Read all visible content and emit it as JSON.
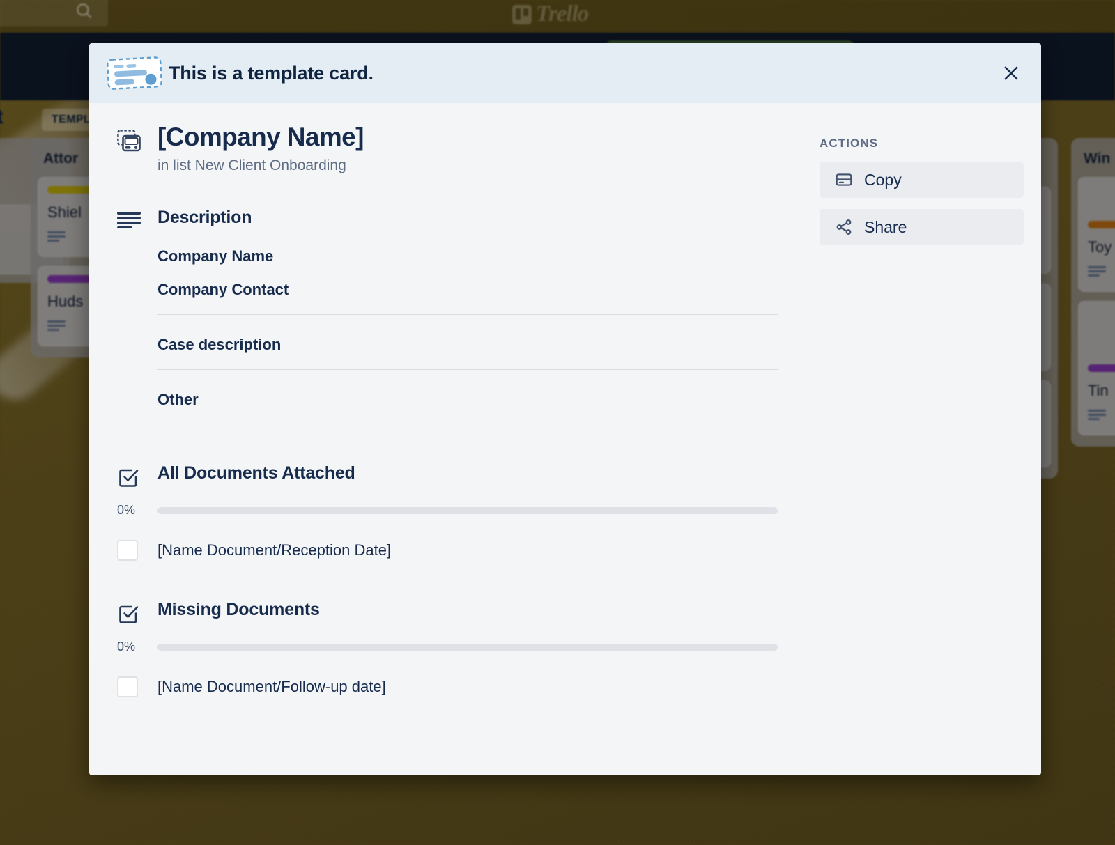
{
  "background": {
    "app_name": "Trello",
    "search_icon": "search-icon",
    "board_title_partial": "nt",
    "template_chip": "TEMPL",
    "lists": [
      {
        "title_partial": "Attor",
        "cards": [
          {
            "title_partial": "Shiel",
            "label_color": "#9a8c0c"
          },
          {
            "title_partial": "Huds",
            "label_color": "#6b2d8f"
          }
        ]
      },
      {
        "title_partial": "Win",
        "cards": [
          {
            "title_partial": "Toy",
            "label_color": "#9c5a10"
          },
          {
            "title_partial": "Tin",
            "label_color": "#6b2d8f"
          }
        ]
      }
    ]
  },
  "modal": {
    "banner": {
      "title": "This is a template card.",
      "template_icon": "template-card-icon",
      "close_icon": "close-icon"
    },
    "card": {
      "icon": "template-card-badge-icon",
      "title": "[Company Name]",
      "subtitle": "in list New Client Onboarding"
    },
    "description": {
      "icon": "description-lines-icon",
      "title": "Description",
      "lines": [
        "Company Name",
        "Company Contact"
      ],
      "sections": [
        "Case description",
        "Other"
      ]
    },
    "checklists": [
      {
        "icon": "checklist-icon",
        "title": "All Documents Attached",
        "percent_label": "0%",
        "percent_value": 0,
        "items": [
          {
            "label": "[Name Document/Reception Date]",
            "checked": false
          }
        ]
      },
      {
        "icon": "checklist-icon",
        "title": "Missing Documents",
        "percent_label": "0%",
        "percent_value": 0,
        "items": [
          {
            "label": "[Name Document/Follow-up date]",
            "checked": false
          }
        ]
      }
    ],
    "actions": {
      "heading": "ACTIONS",
      "buttons": [
        {
          "label": "Copy",
          "icon": "copy-card-icon"
        },
        {
          "label": "Share",
          "icon": "share-icon"
        }
      ]
    }
  },
  "colors": {
    "banner_bg": "#e4ecf4",
    "modal_bg": "#f4f5f7",
    "text_primary": "#172b4d",
    "text_subtle": "#5e6c84",
    "board_bg": "#5a4a1a",
    "board_header": "#0d1625",
    "progress_track": "#dfe1e6",
    "progress_fill": "#5aac44"
  }
}
